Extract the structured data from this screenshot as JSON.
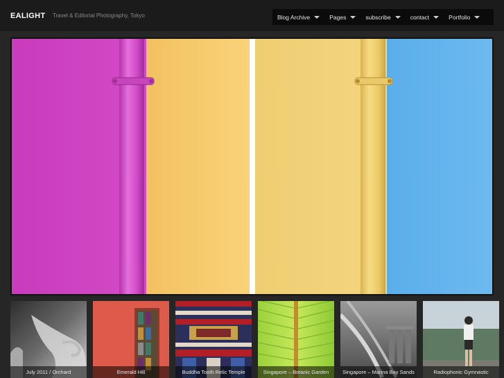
{
  "header": {
    "site_title": "EALIGHT",
    "tagline": "Travel & Editorial Photography, Tokyo"
  },
  "nav": {
    "items": [
      {
        "label": "Blog Archive"
      },
      {
        "label": "Pages"
      },
      {
        "label": "subscribe"
      },
      {
        "label": "contact"
      },
      {
        "label": "Portfolio"
      }
    ]
  },
  "hero": {
    "colors": {
      "magenta": "#cc3ec0",
      "magenta_pipe": "#d84ad0",
      "yellow": "#f8cc6c",
      "yellow_pipe": "#f2cf69",
      "light_yellow": "#f0d27a",
      "blue": "#63b4ef",
      "divider": "#ffffff"
    }
  },
  "thumbnails": [
    {
      "caption": "July 2011 / Orchard"
    },
    {
      "caption": "Emerald Hill"
    },
    {
      "caption": "Buddha Tooth Relic Temple"
    },
    {
      "caption": "Singapore – Botanic Garden"
    },
    {
      "caption": "Singapore – Marina Bay Sands"
    },
    {
      "caption": "Radiophonic Gymnastic"
    }
  ]
}
